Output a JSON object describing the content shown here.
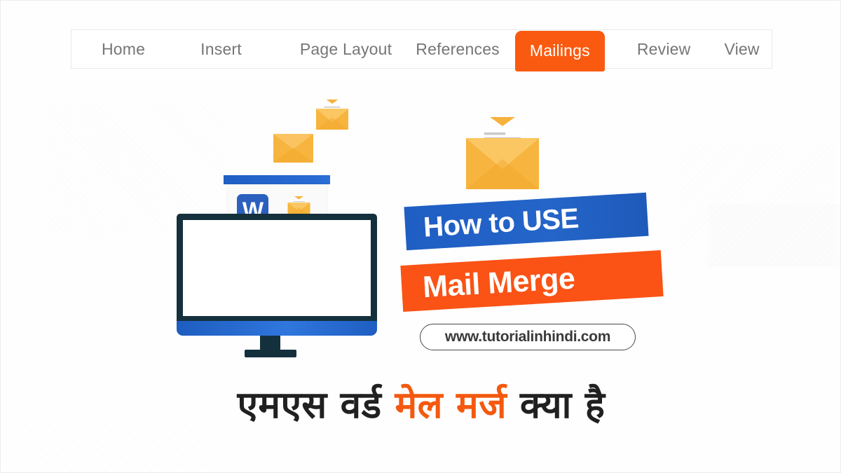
{
  "ribbon": {
    "tabs": [
      {
        "label": "Home",
        "active": false
      },
      {
        "label": "Insert",
        "active": false
      },
      {
        "label": "Page Layout",
        "active": false
      },
      {
        "label": "References",
        "active": false
      },
      {
        "label": "Mailings",
        "active": true
      },
      {
        "label": "Review",
        "active": false
      },
      {
        "label": "View",
        "active": false
      }
    ]
  },
  "illustration": {
    "word_icon_letter": "W",
    "word_icon_name": "microsoft-word-icon",
    "monitor_name": "desktop-monitor-illustration",
    "document_line_count": 8,
    "envelopes": [
      {
        "name": "closed-envelope-icon",
        "state": "closed"
      },
      {
        "name": "open-envelope-small-icon",
        "state": "open"
      },
      {
        "name": "open-envelope-large-icon",
        "state": "open"
      }
    ]
  },
  "banners": {
    "line1": "How to USE",
    "line2": "Mail Merge"
  },
  "url": {
    "text": "www.tutorialinhindi.com"
  },
  "headline": {
    "part1": "एमएस वर्ड ",
    "highlight": "मेल मर्ज",
    "part2": " क्या है",
    "full": "एमएस वर्ड मेल मर्ज क्या है"
  },
  "colors": {
    "orange": "#fa5315",
    "tab_orange": "#fa5a10",
    "blue": "#2163c8",
    "dark_navy": "#15303d",
    "envelope_yellow": "#f7b53f",
    "tab_text_gray": "#767676",
    "doc_line_gray": "#b4b4b4"
  }
}
